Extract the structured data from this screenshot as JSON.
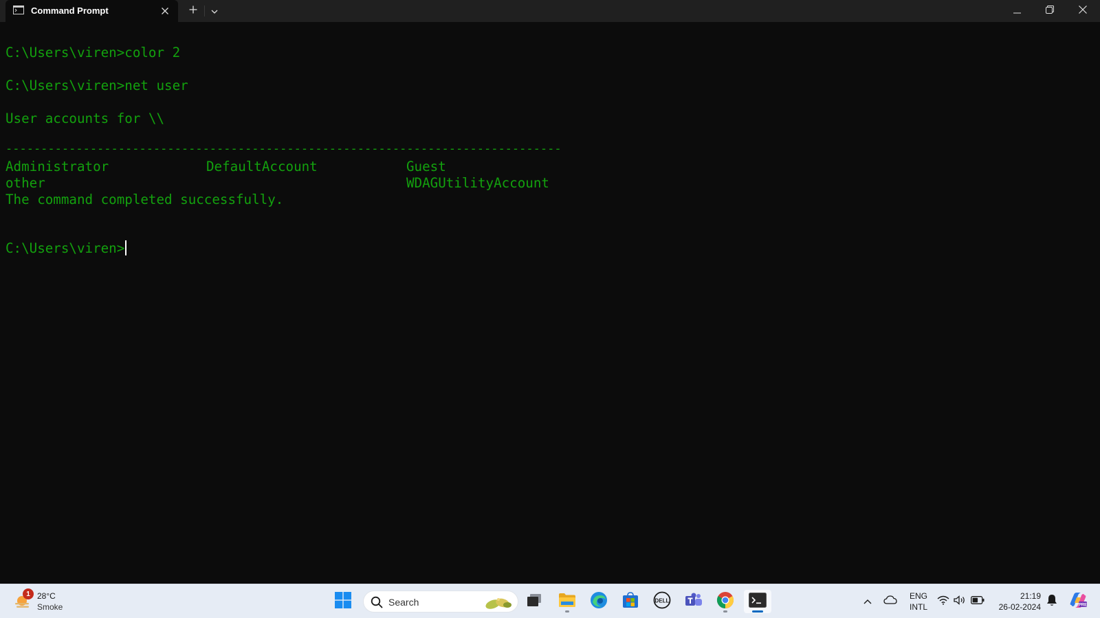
{
  "window": {
    "tab_title": "Command Prompt",
    "tab_icon": "terminal-icon",
    "new_tab_icon": "plus-icon",
    "dropdown_icon": "chevron-down-icon",
    "controls": [
      "minimize-icon",
      "restore-icon",
      "close-icon"
    ]
  },
  "console": {
    "text_color": "#13a10e",
    "background": "#0c0c0c",
    "lines": {
      "cmd1": "C:\\Users\\viren>color 2",
      "cmd2": "C:\\Users\\viren>net user",
      "header": "User accounts for \\\\",
      "separator": "-------------------------------------------------------------------------------",
      "row1_col1": "Administrator",
      "row1_col2": "DefaultAccount",
      "row1_col3": "Guest",
      "row2_col1": "other",
      "row2_col2": "",
      "row2_col3": "WDAGUtilityAccount",
      "status": "The command completed successfully.",
      "prompt": "C:\\Users\\viren>"
    }
  },
  "taskbar": {
    "weather": {
      "badge": "1",
      "temperature": "28°C",
      "condition": "Smoke",
      "icon": "sun-haze-icon"
    },
    "search": {
      "placeholder": "Search",
      "icon": "search-icon"
    },
    "apps": [
      {
        "name": "start-button",
        "icon": "windows-logo-icon"
      },
      {
        "name": "task-view",
        "icon": "task-view-icon"
      },
      {
        "name": "file-explorer",
        "icon": "folder-icon"
      },
      {
        "name": "edge",
        "icon": "edge-icon"
      },
      {
        "name": "microsoft-store",
        "icon": "store-icon"
      },
      {
        "name": "dell",
        "icon": "dell-icon"
      },
      {
        "name": "teams",
        "icon": "teams-icon"
      },
      {
        "name": "chrome",
        "icon": "chrome-icon"
      },
      {
        "name": "terminal",
        "icon": "terminal-icon"
      }
    ],
    "tray": {
      "language_line1": "ENG",
      "language_line2": "INTL",
      "time": "21:19",
      "date": "26-02-2024"
    },
    "accent": "#0067c0"
  }
}
